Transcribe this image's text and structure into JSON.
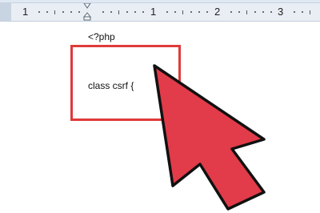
{
  "ruler": {
    "numbers": [
      "1",
      "1",
      "2",
      "3"
    ],
    "icons": {
      "indent": "indent-marker-icon"
    }
  },
  "document": {
    "code_lines": [
      "<?php",
      "class csrf {"
    ]
  },
  "annotation": {
    "highlight_color": "#e03a3a",
    "arrow_fill": "#e23b49",
    "arrow_outline": "#111111",
    "icon": "pointer-arrow-icon"
  }
}
